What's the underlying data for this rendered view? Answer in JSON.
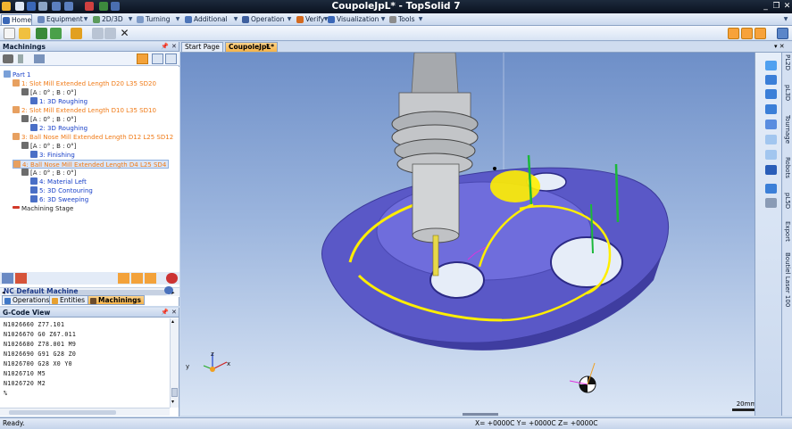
{
  "window": {
    "title": "CoupoleJpL* - TopSolid 7",
    "controls": {
      "minimize": "_",
      "restore": "❐",
      "close": "✕"
    }
  },
  "menu": {
    "items": [
      {
        "label": "Home",
        "icon": "home-icon",
        "active": true
      },
      {
        "label": "Equipment",
        "icon": "equipment-icon"
      },
      {
        "label": "2D/3D",
        "icon": "2d3d-icon"
      },
      {
        "label": "Turning",
        "icon": "turning-icon"
      },
      {
        "label": "Additional",
        "icon": "additional-icon"
      },
      {
        "label": "Operation",
        "icon": "operation-icon"
      },
      {
        "label": "Verify",
        "icon": "verify-icon"
      },
      {
        "label": "Visualization",
        "icon": "visualization-icon"
      },
      {
        "label": "Tools",
        "icon": "tools-icon"
      }
    ]
  },
  "doc_tabs": [
    {
      "label": "Start Page",
      "active": false
    },
    {
      "label": "CoupoleJpL*",
      "active": true
    }
  ],
  "machinings_panel": {
    "title": "Machinings",
    "tree": [
      {
        "text": "Part 1",
        "color": "blue",
        "indent": 0
      },
      {
        "text": "1: Slot Mill Extended Length D20 L35 SD20",
        "color": "orange",
        "indent": 1
      },
      {
        "text": "[A : 0° ; B : 0°]",
        "color": "black",
        "indent": 2
      },
      {
        "text": "1: 3D Roughing",
        "color": "blue",
        "indent": 3
      },
      {
        "text": "2: Slot Mill Extended Length D10 L35 SD10",
        "color": "orange",
        "indent": 1
      },
      {
        "text": "[A : 0° ; B : 0°]",
        "color": "black",
        "indent": 2
      },
      {
        "text": "2: 3D Roughing",
        "color": "blue",
        "indent": 3
      },
      {
        "text": "3: Ball Nose Mill Extended Length D12 L25 SD12",
        "color": "orange",
        "indent": 1
      },
      {
        "text": "[A : 0° ; B : 0°]",
        "color": "black",
        "indent": 2
      },
      {
        "text": "3: Finishing",
        "color": "blue",
        "indent": 3
      },
      {
        "text": "4: Ball Nose Mill Extended Length D4 L25 SD4",
        "color": "orange",
        "indent": 1
      },
      {
        "text": "[A : 0° ; B : 0°]",
        "color": "black",
        "indent": 2
      },
      {
        "text": "4: Material Left",
        "color": "blue",
        "indent": 3
      },
      {
        "text": "5: 3D Contouring",
        "color": "blue",
        "indent": 3
      },
      {
        "text": "6: 3D Sweeping",
        "color": "blue",
        "indent": 3
      },
      {
        "text": "Machining Stage",
        "color": "black",
        "indent": 0
      }
    ],
    "machine_label": "NC Default Machine",
    "bottom_tabs": [
      {
        "label": "Operations",
        "active": false
      },
      {
        "label": "Entities",
        "active": false
      },
      {
        "label": "Machinings",
        "active": true
      }
    ]
  },
  "gcode_panel": {
    "title": "G-Code View",
    "lines": [
      "N1026660 Z77.101",
      "N1026670 G0 Z67.011",
      "N1026680 Z78.001 M9",
      "N1026690 G91 G28 Z0",
      "N1026700 G28 X0 Y0",
      "N1026710 M5",
      "N1026720 M2",
      "%"
    ]
  },
  "side_tabs": [
    "PL2D",
    "pL3D",
    "Tournage",
    "Robots",
    "pL5D",
    "Export",
    "Boutiel Laser 100"
  ],
  "viewport": {
    "scale_label": "20mm",
    "axis_labels": {
      "x": "x",
      "y": "y",
      "z": "z"
    }
  },
  "status": {
    "left": "Ready.",
    "coords": "X= +0000C Y= +0000C Z= +0000C"
  }
}
